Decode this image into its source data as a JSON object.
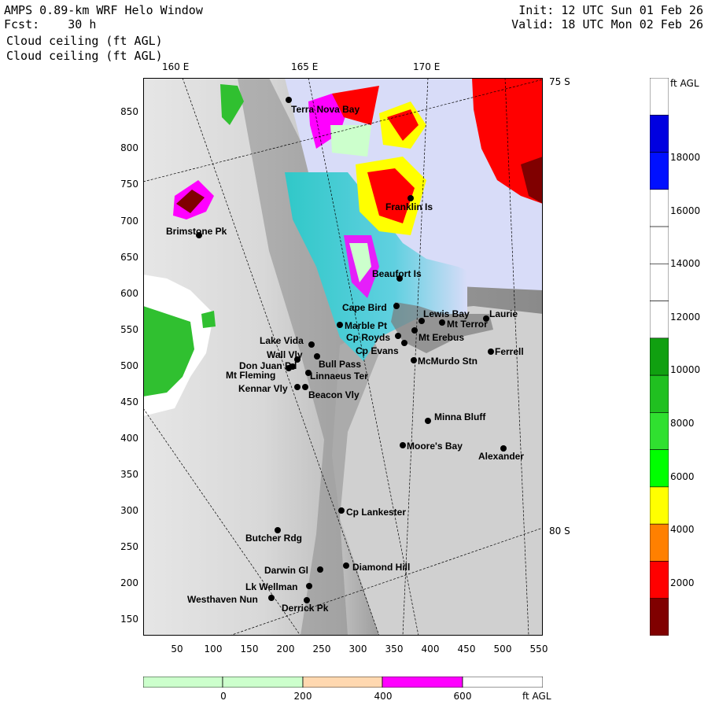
{
  "header": {
    "title": "AMPS 0.89-km WRF Helo Window",
    "fcst": "Fcst:    30 h",
    "field1": "Cloud ceiling (ft AGL)",
    "field2": "Cloud ceiling (ft AGL)",
    "init": "Init: 12 UTC Sun 01 Feb 26",
    "valid": "Valid: 18 UTC Mon 02 Feb 26"
  },
  "axes": {
    "x_ticks": [
      "50",
      "100",
      "150",
      "200",
      "250",
      "300",
      "350",
      "400",
      "450",
      "500",
      "550"
    ],
    "y_ticks": [
      "150",
      "200",
      "250",
      "300",
      "350",
      "400",
      "450",
      "500",
      "550",
      "600",
      "650",
      "700",
      "750",
      "800",
      "850"
    ],
    "lon_labels": [
      "160 E",
      "165 E",
      "170 E"
    ],
    "lat_labels": [
      "75 S",
      "80 S"
    ]
  },
  "colorbar": {
    "unit": "ft AGL",
    "labels": [
      "18000",
      "16000",
      "14000",
      "12000",
      "10000",
      "8000",
      "6000",
      "4000",
      "2000"
    ],
    "colors": [
      "#ffffff",
      "#0000e0",
      "#0010ff",
      "#ffffff",
      "#ffffff",
      "#ffffff",
      "#ffffff",
      "#10a010",
      "#20c020",
      "#30e030",
      "#00ff00",
      "#ffff00",
      "#ff8000",
      "#ff0000",
      "#800000"
    ]
  },
  "hbar": {
    "unit": "ft AGL",
    "labels": [
      "0",
      "200",
      "400",
      "600"
    ],
    "colors": [
      "#ccffcc",
      "#ccffcc",
      "#ffd8b0",
      "#ff00ff",
      "#ffffff"
    ]
  },
  "places": [
    {
      "name": "Terra Nova Bay"
    },
    {
      "name": "Franklin Is"
    },
    {
      "name": "Brimstone Pk"
    },
    {
      "name": "Beaufort Is"
    },
    {
      "name": "Cape Bird"
    },
    {
      "name": "Lewis Bay"
    },
    {
      "name": "Laurie"
    },
    {
      "name": "Mt Terror"
    },
    {
      "name": "Marble Pt"
    },
    {
      "name": "Cp Royds"
    },
    {
      "name": "Mt Erebus"
    },
    {
      "name": "Cp Evans"
    },
    {
      "name": "Ferrell"
    },
    {
      "name": "Lake Vida"
    },
    {
      "name": "Wall Vly"
    },
    {
      "name": "Bull Pass"
    },
    {
      "name": "Don Juan Pd"
    },
    {
      "name": "McMurdo Stn"
    },
    {
      "name": "Mt Fleming"
    },
    {
      "name": "Linnaeus Ter"
    },
    {
      "name": "Kennar Vly"
    },
    {
      "name": "Beacon Vly"
    },
    {
      "name": "Minna Bluff"
    },
    {
      "name": "Moore's Bay"
    },
    {
      "name": "Alexander"
    },
    {
      "name": "Cp Lankester"
    },
    {
      "name": "Butcher Rdg"
    },
    {
      "name": "Darwin Gl"
    },
    {
      "name": "Diamond Hill"
    },
    {
      "name": "Lk Wellman"
    },
    {
      "name": "Westhaven Nun"
    },
    {
      "name": "Derrick Pk"
    }
  ]
}
